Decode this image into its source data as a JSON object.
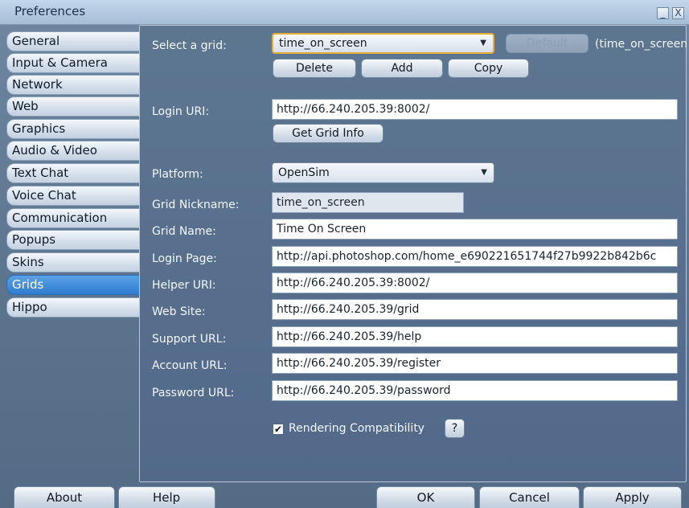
{
  "window": {
    "title": "Preferences",
    "minimize_glyph": "_",
    "close_glyph": "X"
  },
  "tabs": [
    "General",
    "Input & Camera",
    "Network",
    "Web",
    "Graphics",
    "Audio & Video",
    "Text Chat",
    "Voice Chat",
    "Communication",
    "Popups",
    "Skins",
    "Grids",
    "Hippo"
  ],
  "active_tab": "Grids",
  "grid": {
    "select_label": "Select a grid:",
    "selected": "time_on_screen",
    "default_label": "Default",
    "current_note": "(time_on_screen",
    "delete_label": "Delete",
    "add_label": "Add",
    "copy_label": "Copy"
  },
  "login": {
    "label": "Login URI:",
    "value": "http://66.240.205.39:8002/",
    "get_info_label": "Get Grid Info"
  },
  "platform": {
    "label": "Platform:",
    "value": "OpenSim"
  },
  "fields": {
    "nickname": {
      "label": "Grid Nickname:",
      "value": "time_on_screen"
    },
    "name": {
      "label": "Grid Name:",
      "value": "Time On Screen"
    },
    "login_page": {
      "label": "Login Page:",
      "value": "http://api.photoshop.com/home_e690221651744f27b9922b842b6c"
    },
    "helper_uri": {
      "label": "Helper URI:",
      "value": "http://66.240.205.39:8002/"
    },
    "web_site": {
      "label": "Web Site:",
      "value": "http://66.240.205.39/grid"
    },
    "support_url": {
      "label": "Support URL:",
      "value": "http://66.240.205.39/help"
    },
    "account_url": {
      "label": "Account URL:",
      "value": "http://66.240.205.39/register"
    },
    "password_url": {
      "label": "Password URL:",
      "value": "http://66.240.205.39/password"
    }
  },
  "rendering": {
    "label": "Rendering Compatibility",
    "checked": true,
    "check_glyph": "✔",
    "help_glyph": "?"
  },
  "footer": {
    "about": "About",
    "help": "Help",
    "ok": "OK",
    "cancel": "Cancel",
    "apply": "Apply"
  },
  "colors": {
    "active_tab": "#2f7ccf",
    "focus_border": "#e6ad3b",
    "panel": "#5d7690"
  }
}
